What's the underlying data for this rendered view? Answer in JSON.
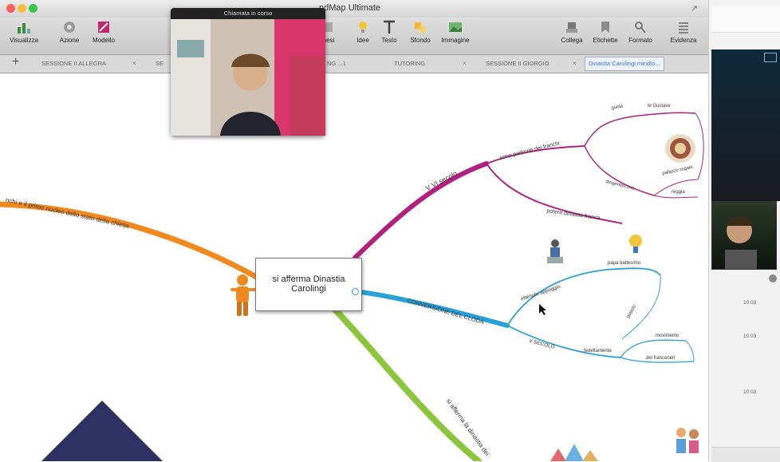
{
  "window": {
    "title": "ndMap Ultimate"
  },
  "video_call": {
    "title": "Chiamata in corso"
  },
  "toolbar": {
    "left_buttons": [
      "Visualizza",
      "Azione",
      "Modello"
    ],
    "mid_buttons": [
      "nesi",
      "Idee",
      "Testo",
      "Sfondo",
      "Immagine"
    ],
    "right_buttons": [
      "Collega",
      "Etichette",
      "Formato",
      "Evidenza"
    ]
  },
  "tabs": [
    {
      "label": "SESSIONE II ALLEGRA"
    },
    {
      "label": "SE"
    },
    {
      "label": "NG ...1"
    },
    {
      "label": "TUTORING"
    },
    {
      "label": "SESSIONE II GIORGIO"
    },
    {
      "label": "Dinastia Carolingi mindto..."
    }
  ],
  "map": {
    "central_line1": "si afferma Dinastia",
    "central_line2": "Carolingi",
    "orange_branch": "nchi e il primo nucleo dello stato della chiesa",
    "purple_branch": "V VI secolo",
    "purple_sub1": "sono padrone del franchi",
    "purple_sub2": "potere dinastia franca",
    "purple_leaf1": "guida",
    "purple_leaf2": "le Gustave",
    "purple_leaf3": "dirigentiscono",
    "purple_leaf4": "palazzo regale",
    "purple_leaf5": "reggia",
    "blue_branch": "CONVERSIONE DEL CLODA",
    "blue_sub1": "ottenuto appoggio",
    "blue_sub2": "V SECOLO",
    "blue_leaf1": "papa battesimo",
    "blue_leaf2": "popolo",
    "blue_leaf3": "fedeltamente",
    "blue_leaf4": "movimento",
    "blue_leaf5": "dei franconeri",
    "green_branch": "si afferma la dinastia dei"
  },
  "side_times": [
    "10:03",
    "10:03",
    "10:03"
  ],
  "colors": {
    "orange": "#f08a1e",
    "purple": "#b2207e",
    "blue": "#2aa0d8",
    "green": "#8cc63e",
    "navy": "#2e3262",
    "active_tab": "#3b6fd8"
  }
}
